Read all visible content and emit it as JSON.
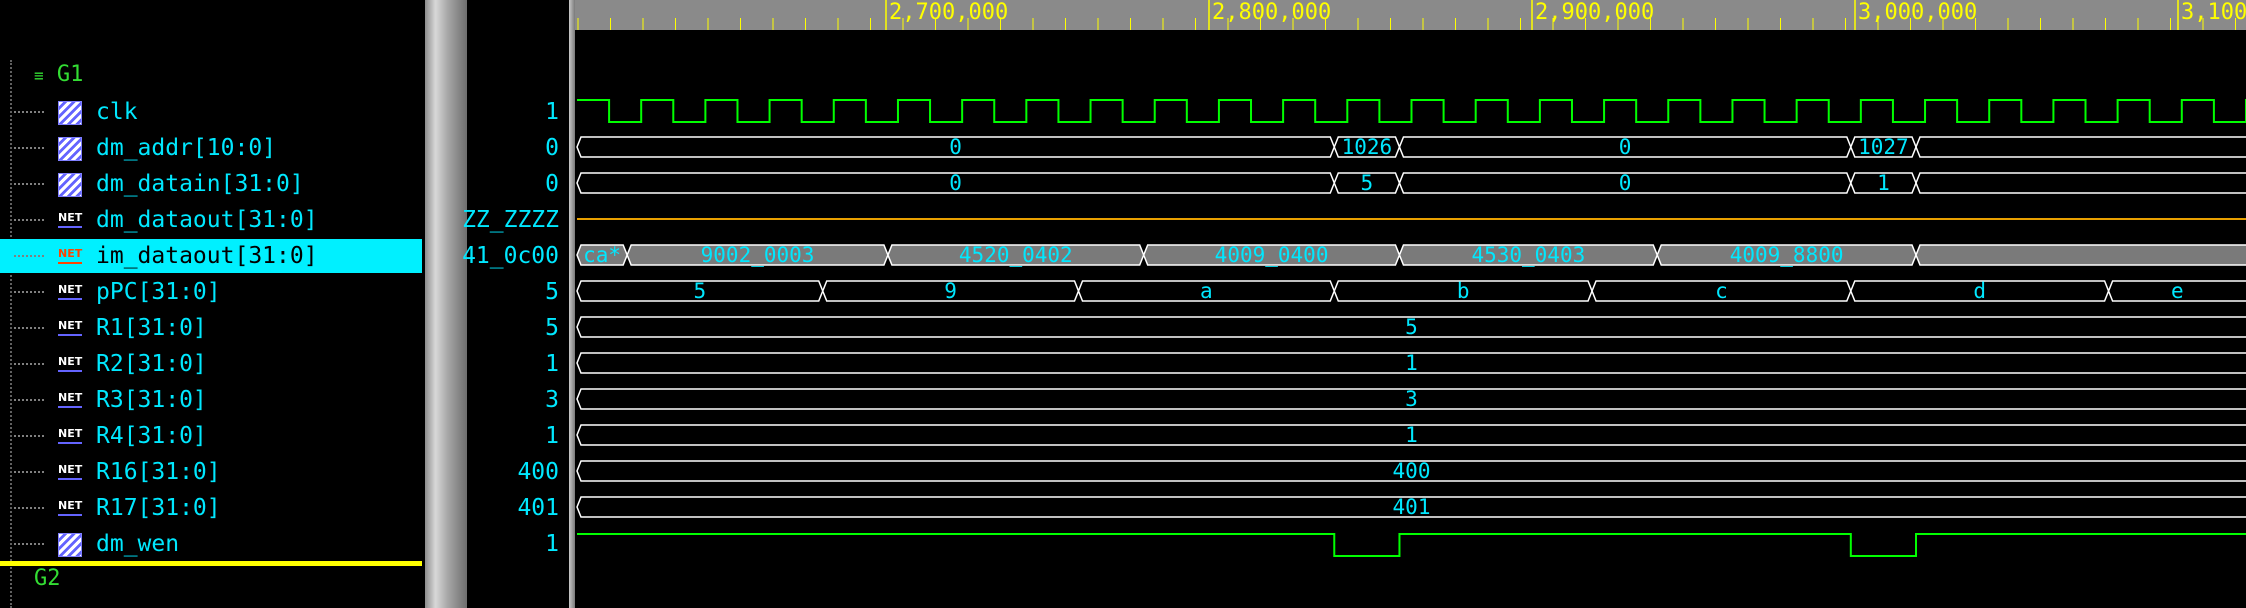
{
  "ruler": {
    "ticks": [
      {
        "label": "2,700,000",
        "pos": 0.14
      },
      {
        "label": "2,800,000",
        "pos": 0.45
      },
      {
        "label": "2,900,000",
        "pos": 0.77
      },
      {
        "label": "3,000,000",
        "pos": 1.08
      },
      {
        "label": "3,100,000",
        "pos": 1.39
      }
    ]
  },
  "groups": {
    "g1": "G1",
    "g2": "G2"
  },
  "signals": [
    {
      "name": "clk",
      "kind": "reg",
      "value": "1",
      "selected": false
    },
    {
      "name": "dm_addr[10:0]",
      "kind": "reg",
      "value": "0",
      "selected": false
    },
    {
      "name": "dm_datain[31:0]",
      "kind": "reg",
      "value": "0",
      "selected": false
    },
    {
      "name": "dm_dataout[31:0]",
      "kind": "net",
      "value": "ZZ_ZZZZ",
      "selected": false
    },
    {
      "name": "im_dataout[31:0]",
      "kind": "net",
      "value": "41_0c00",
      "selected": true
    },
    {
      "name": "pPC[31:0]",
      "kind": "net",
      "value": "5",
      "selected": false
    },
    {
      "name": "R1[31:0]",
      "kind": "net",
      "value": "5",
      "selected": false
    },
    {
      "name": "R2[31:0]",
      "kind": "net",
      "value": "1",
      "selected": false
    },
    {
      "name": "R3[31:0]",
      "kind": "net",
      "value": "3",
      "selected": false
    },
    {
      "name": "R4[31:0]",
      "kind": "net",
      "value": "1",
      "selected": false
    },
    {
      "name": "R16[31:0]",
      "kind": "net",
      "value": "400",
      "selected": false
    },
    {
      "name": "R17[31:0]",
      "kind": "net",
      "value": "401",
      "selected": false
    },
    {
      "name": "dm_wen",
      "kind": "reg",
      "value": "1",
      "selected": false
    }
  ],
  "icon_text": {
    "net": "NET"
  },
  "waves": {
    "dm_addr": [
      {
        "t0": 0.0,
        "t1": 0.755,
        "label": "0"
      },
      {
        "t0": 0.755,
        "t1": 0.82,
        "label": "1026"
      },
      {
        "t0": 0.82,
        "t1": 1.27,
        "label": "0"
      },
      {
        "t0": 1.27,
        "t1": 1.335,
        "label": "1027"
      },
      {
        "t0": 1.335,
        "t1": 2.0,
        "label": ""
      }
    ],
    "dm_datain": [
      {
        "t0": 0.0,
        "t1": 0.755,
        "label": "0"
      },
      {
        "t0": 0.755,
        "t1": 0.82,
        "label": "5"
      },
      {
        "t0": 0.82,
        "t1": 1.27,
        "label": "0"
      },
      {
        "t0": 1.27,
        "t1": 1.335,
        "label": "1"
      },
      {
        "t0": 1.335,
        "t1": 2.0,
        "label": ""
      }
    ],
    "im_dataout": [
      {
        "t0": 0.0,
        "t1": 0.05,
        "label": "ca*"
      },
      {
        "t0": 0.05,
        "t1": 0.31,
        "label": "9002_0003"
      },
      {
        "t0": 0.31,
        "t1": 0.565,
        "label": "4520_0402"
      },
      {
        "t0": 0.565,
        "t1": 0.82,
        "label": "4009_0400"
      },
      {
        "t0": 0.82,
        "t1": 1.077,
        "label": "4530_0403"
      },
      {
        "t0": 1.077,
        "t1": 1.335,
        "label": "4009_8800"
      },
      {
        "t0": 1.335,
        "t1": 2.0,
        "label": ""
      }
    ],
    "pPC": [
      {
        "t0": 0.0,
        "t1": 0.245,
        "label": "5"
      },
      {
        "t0": 0.245,
        "t1": 0.5,
        "label": "9"
      },
      {
        "t0": 0.5,
        "t1": 0.755,
        "label": "a"
      },
      {
        "t0": 0.755,
        "t1": 1.012,
        "label": "b"
      },
      {
        "t0": 1.012,
        "t1": 1.27,
        "label": "c"
      },
      {
        "t0": 1.27,
        "t1": 1.527,
        "label": "d"
      },
      {
        "t0": 1.527,
        "t1": 2.0,
        "label": "e"
      }
    ],
    "R1": [
      {
        "t0": 0.0,
        "t1": 2.0,
        "label": "5"
      }
    ],
    "R2": [
      {
        "t0": 0.0,
        "t1": 2.0,
        "label": "1"
      }
    ],
    "R3": [
      {
        "t0": 0.0,
        "t1": 2.0,
        "label": "3"
      }
    ],
    "R4": [
      {
        "t0": 0.0,
        "t1": 2.0,
        "label": "1"
      }
    ],
    "R16": [
      {
        "t0": 0.0,
        "t1": 2.0,
        "label": "400"
      }
    ],
    "R17": [
      {
        "t0": 0.0,
        "t1": 2.0,
        "label": "401"
      }
    ],
    "dm_wen_low": [
      [
        0.755,
        0.82
      ],
      [
        1.27,
        1.335
      ]
    ],
    "clk_half_period": 0.032
  },
  "colors": {
    "bus": "#ffffff",
    "bus_text": "#00e8ff",
    "clk": "#00ff00",
    "highz": "#e8a000",
    "selected_fill": "#7a7a7a",
    "ruler": "#8a8a8a",
    "ruler_text": "#ffff00",
    "group": "#33dd33",
    "g2_line": "#ffff00"
  }
}
